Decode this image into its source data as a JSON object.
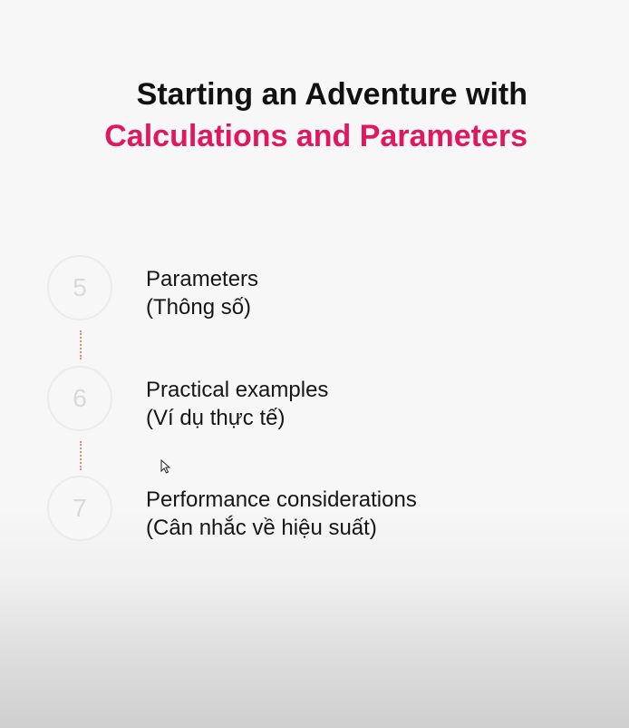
{
  "slide": {
    "title_line1": "Starting an Adventure with",
    "title_line2": "Calculations and Parameters",
    "accent_color": "#e0185f",
    "steps": [
      {
        "number": "5",
        "title": "Parameters",
        "subtitle": "(Thông số)"
      },
      {
        "number": "6",
        "title": "Practical examples",
        "subtitle": "(Ví dụ thực tế)"
      },
      {
        "number": "7",
        "title": "Performance considerations",
        "subtitle": "(Cân nhắc về hiệu suất)"
      }
    ]
  },
  "cursor_icon": "mouse-pointer-icon"
}
